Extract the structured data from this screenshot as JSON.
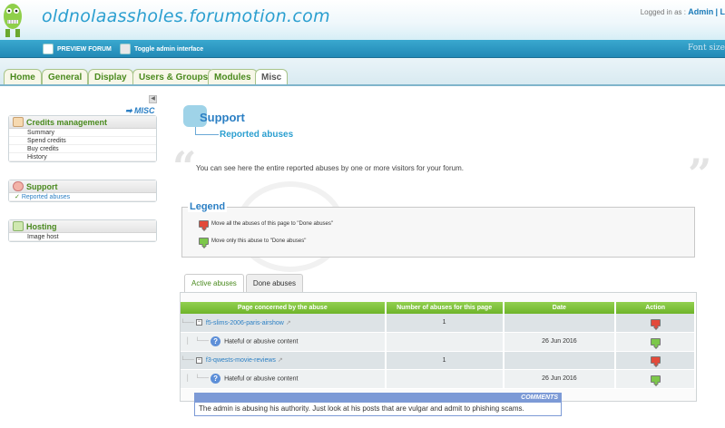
{
  "header": {
    "site_title": "oldnolaassholes.forumotion.com",
    "logged_prefix": "Logged in as :",
    "user": "Admin",
    "user_suffix": "| L"
  },
  "toolbar": {
    "preview_label": "PREVIEW FORUM",
    "admin_toggle_label": "Toggle admin interface",
    "font_size_label": "Font size"
  },
  "tabs": [
    "Home",
    "General",
    "Display",
    "Users & Groups",
    "Modules",
    "Misc"
  ],
  "sidebar": {
    "misc_link": "➡ MISC",
    "sections": [
      {
        "title": "Credits management",
        "items": [
          "Summary",
          "Spend credits",
          "Buy credits",
          "History"
        ]
      },
      {
        "title": "Support",
        "items": [
          "Reported abuses"
        ]
      },
      {
        "title": "Hosting",
        "items": [
          "Image host"
        ]
      }
    ]
  },
  "main": {
    "title": "Support",
    "subtitle": "Reported abuses",
    "intro": "You can see here the entire reported abuses by one or more visitors for your forum.",
    "legend": {
      "title": "Legend",
      "items": [
        "Move all the abuses of this page to \"Done abuses\"",
        "Move only this abuse to \"Done abuses\""
      ]
    },
    "subtabs": [
      "Active abuses",
      "Done abuses"
    ],
    "table": {
      "headers": [
        "Page concerned by the abuse",
        "Number of abuses for this page",
        "Date",
        "Action"
      ],
      "rows": [
        {
          "type": "page",
          "name": "f5-slims-2006-paris-airshow",
          "count": "1"
        },
        {
          "type": "abuse",
          "reason": "Hateful or abusive content",
          "date": "26 Jun 2016"
        },
        {
          "type": "page",
          "name": "f3-qwests-movie-reviews",
          "count": "1"
        },
        {
          "type": "abuse",
          "reason": "Hateful or abusive content",
          "date": "26 Jun 2016"
        }
      ]
    },
    "comments": {
      "header": "COMMENTS",
      "text": "The admin is abusing his authority.  Just look at his posts that are vulgar and admit to phishing scams."
    }
  },
  "colors": {
    "accent_blue": "#2b9fd0",
    "tab_green": "#4a8a1e",
    "table_header_green": "#7cc13a",
    "comments_header": "#7c9ad6"
  }
}
